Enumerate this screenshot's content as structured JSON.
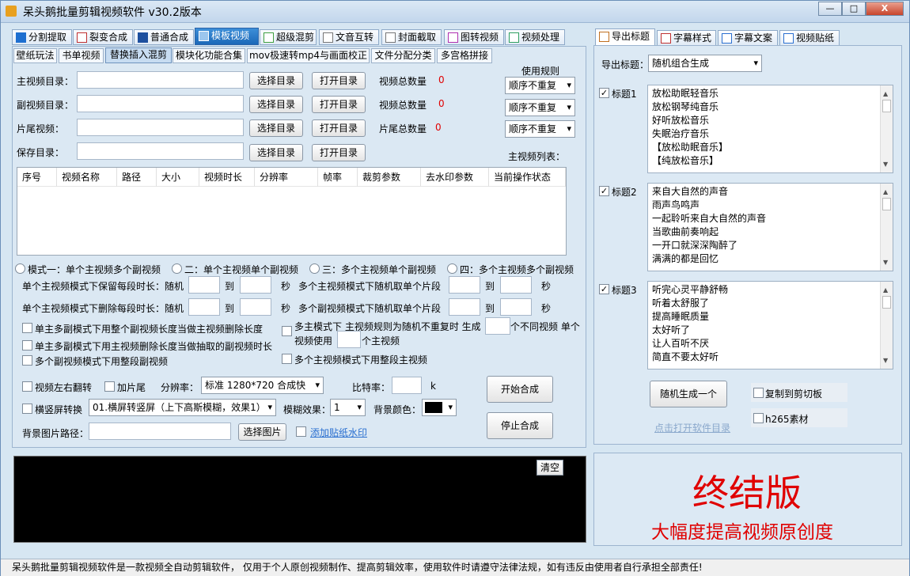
{
  "window": {
    "title": "呆头鹅批量剪辑视频软件   v30.2版本",
    "minimize": "—",
    "maximize": "□",
    "close": "X"
  },
  "main_tabs": [
    {
      "label": "分割提取"
    },
    {
      "label": "裂变合成"
    },
    {
      "label": "普通合成"
    },
    {
      "label": "模板视频"
    },
    {
      "label": "超级混剪"
    },
    {
      "label": "文音互转"
    },
    {
      "label": "封面截取"
    },
    {
      "label": "图转视频"
    },
    {
      "label": "视频处理"
    }
  ],
  "sub_tabs": [
    {
      "label": "壁纸玩法"
    },
    {
      "label": "书单视频"
    },
    {
      "label": "替换插入混剪"
    },
    {
      "label": "模块化功能合集"
    },
    {
      "label": "mov极速转mp4与画面校正"
    },
    {
      "label": "文件分配分类"
    },
    {
      "label": "多宫格拼接"
    }
  ],
  "form": {
    "main_dir_label": "主视频目录：",
    "sub_dir_label": "副视频目录：",
    "tail_label": "片尾视频：",
    "save_dir_label": "保存目录：",
    "select_dir": "选择目录",
    "open_dir": "打开目录",
    "video_total_label": "视频总数量",
    "tail_total_label": "片尾总数量",
    "count0": "0",
    "rule_label": "使用规则",
    "rule_value": "顺序不重复",
    "main_list_label": "主视频列表："
  },
  "table": {
    "columns": [
      "序号",
      "视频名称",
      "路径",
      "大小",
      "视频时长",
      "分辨率",
      "帧率",
      "裁剪参数",
      "去水印参数",
      "当前操作状态"
    ]
  },
  "modes": [
    "模式一：单个主视频多个副视频",
    "二：单个主视频单个副视频",
    "三：多个主视频单个副视频",
    "四：多个主视频多个副视频"
  ],
  "options": {
    "keep_label": "单个主视频模式下保留每段时长：随机",
    "delete_label": "单个主视频模式下删除每段时长：随机",
    "to": "到",
    "sec": "秒",
    "multi_main_random": "多个主视频模式下随机取单个片段",
    "multi_sub_random": "多个副视频模式下随机取单个片段",
    "chk1": "单主多副模式下用整个副视频长度当做主视频删除长度",
    "chk2": "单主多副模式下用主视频删除长度当做抽取的副视频时长",
    "chk3": "多个副视频模式下用整段副视频",
    "chk4a": "多主模式下 主视频规则为随机不重复时 生成",
    "chk4b": "个不同视频 单个",
    "chk4c": "视频使用",
    "chk4d": "个主视频",
    "chk5": "多个主视频模式下用整段主视频",
    "flip": "视频左右翻转",
    "add_tail": "加片尾",
    "resolution_label": "分辨率：",
    "resolution_value": "标准 1280*720 合成快",
    "bitrate_label": "比特率：",
    "bitrate_unit": "k",
    "orient": "横竖屏转换",
    "orient_value": "01.横屏转竖屏（上下高斯模糊，效果1）",
    "blur_label": "模糊效果：",
    "blur_value": "1",
    "bg_color_label": "背景颜色：",
    "bg_color": "#000000",
    "bg_path_label": "背景图片路径：",
    "select_image": "选择图片",
    "watermark_link": "添加贴纸水印",
    "start": "开始合成",
    "stop": "停止合成"
  },
  "console": {
    "clear": "清空"
  },
  "right_tabs": [
    {
      "label": "导出标题"
    },
    {
      "label": "字幕样式"
    },
    {
      "label": "字幕文案"
    },
    {
      "label": "视频贴纸"
    }
  ],
  "right": {
    "export_label": "导出标题：",
    "export_value": "随机组合生成",
    "title_groups": [
      {
        "label": "标题1",
        "lines": [
          "放松助眠轻音乐",
          "放松钢琴纯音乐",
          "好听放松音乐",
          "失眠治疗音乐",
          "【放松助眠音乐】",
          "【纯放松音乐】"
        ]
      },
      {
        "label": "标题2",
        "lines": [
          "来自大自然的声音",
          "雨声鸟鸣声",
          "一起聆听来自大自然的声音",
          "当歌曲前奏响起",
          "一开口就深深陶醉了",
          "满满的都是回忆"
        ]
      },
      {
        "label": "标题3",
        "lines": [
          "听完心灵平静舒畅",
          "听着太舒服了",
          "提高睡眠质量",
          "太好听了",
          "让人百听不厌",
          "简直不要太好听"
        ]
      }
    ],
    "random_btn": "随机生成一个",
    "copy_clip": "复制到剪切板",
    "h265": "h265素材",
    "open_dir_link": "点击打开软件目录"
  },
  "promo": {
    "line1": "终结版",
    "line2": "大幅度提高视频原创度"
  },
  "statusbar": "呆头鹅批量剪辑视频软件是一款视频全自动剪辑软件，  仅用于个人原创视频制作、提高剪辑效率，使用软件时请遵守法律法规，如有违反由使用者自行承担全部责任!"
}
